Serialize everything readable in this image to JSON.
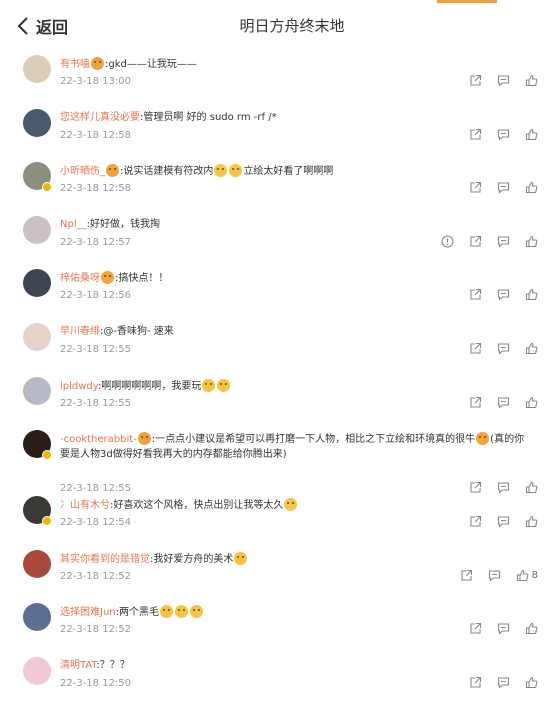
{
  "header": {
    "back_label": "返回",
    "title": "明日方舟终末地"
  },
  "colors": {
    "accent": "#f39c3a",
    "username": "#eb7350",
    "badge": "#f7b500"
  },
  "comments": [
    {
      "user": "有书嗑",
      "sep": ":",
      "text": "gkd——让我玩——",
      "time": "22-3-18 13:00",
      "emojis_after_user": 1,
      "emojis_end": 0,
      "avatar": "#d9cdb8",
      "badge": false,
      "report": false,
      "likes": ""
    },
    {
      "user": "您这样儿真没必要",
      "sep": ":",
      "text": "管理员啊 好的 sudo rm -rf /*",
      "time": "22-3-18 12:58",
      "emojis_after_user": 0,
      "emojis_end": 0,
      "avatar": "#4a5a6e",
      "badge": false,
      "report": false,
      "likes": ""
    },
    {
      "user": "小昕晒伤_",
      "sep": "",
      "text": "说实话建模有符改内",
      "text2": "立绘太好看了啊啊啊",
      "time": "22-3-18 12:58",
      "emojis_after_user": 1,
      "emojis_end": 2,
      "avatar": "#8b8f7e",
      "badge": true,
      "report": false,
      "likes": ""
    },
    {
      "user": "Npl__",
      "sep": ":",
      "text": "好好做，钱我掏",
      "time": "22-3-18 12:57",
      "emojis_after_user": 0,
      "emojis_end": 0,
      "avatar": "#c9c1c4",
      "badge": false,
      "report": true,
      "likes": ""
    },
    {
      "user": "梓佑桑呀",
      "sep": "",
      "text": "搞快点！！",
      "time": "22-3-18 12:56",
      "emojis_after_user": 1,
      "emojis_end": 0,
      "avatar": "#3d4551",
      "badge": false,
      "report": false,
      "likes": ""
    },
    {
      "user": "早川春绯",
      "sep": ":",
      "text": "@-香味狗- 速来",
      "time": "22-3-18 12:55",
      "emojis_after_user": 0,
      "emojis_end": 0,
      "avatar": "#e7d2c9",
      "badge": false,
      "report": false,
      "likes": ""
    },
    {
      "user": "lpldwdy",
      "sep": ":",
      "text": "啊啊啊啊啊啊，我要玩",
      "time": "22-3-18 12:55",
      "emojis_after_user": 0,
      "emojis_end": 2,
      "avatar": "#b7b9c4",
      "badge": false,
      "report": false,
      "likes": ""
    },
    {
      "user": "-cooktherabbit-",
      "sep": "",
      "text": "一点点小建议是希望可以再打磨一下人物，相比之下立绘和环境真的很牛",
      "text3": "(真的你要是人物3d做得好看我再大的内存都能给你腾出来)",
      "time": "22-3-18 12:55",
      "emojis_after_user": 1,
      "emojis_end": 1,
      "avatar": "#2b1d1a",
      "badge": true,
      "report": false,
      "likes": "",
      "tall": true
    },
    {
      "user": "冫山有木兮",
      "sep": ":",
      "text": "好喜欢这个风格，快点出别让我等太久",
      "time": "22-3-18 12:54",
      "emojis_after_user": 0,
      "emojis_end": 1,
      "avatar": "#3c3a36",
      "badge": true,
      "report": false,
      "likes": ""
    },
    {
      "user": "其实你看到的是错觉",
      "sep": ":",
      "text": "我好爱方舟的美术",
      "time": "22-3-18 12:52",
      "emojis_after_user": 0,
      "emojis_end": 1,
      "avatar": "#a8493b",
      "badge": false,
      "report": false,
      "likes": "8"
    },
    {
      "user": "选择困难Jun",
      "sep": ":",
      "text": "两个黑毛",
      "time": "22-3-18 12:52",
      "emojis_after_user": 0,
      "emojis_end": 3,
      "avatar": "#5b6f93",
      "badge": false,
      "report": false,
      "likes": ""
    },
    {
      "user": "清明TAT",
      "sep": ":",
      "text": "？？？",
      "time": "22-3-18 12:50",
      "emojis_after_user": 0,
      "emojis_end": 0,
      "avatar": "#f0c9d4",
      "badge": false,
      "report": false,
      "likes": ""
    }
  ]
}
